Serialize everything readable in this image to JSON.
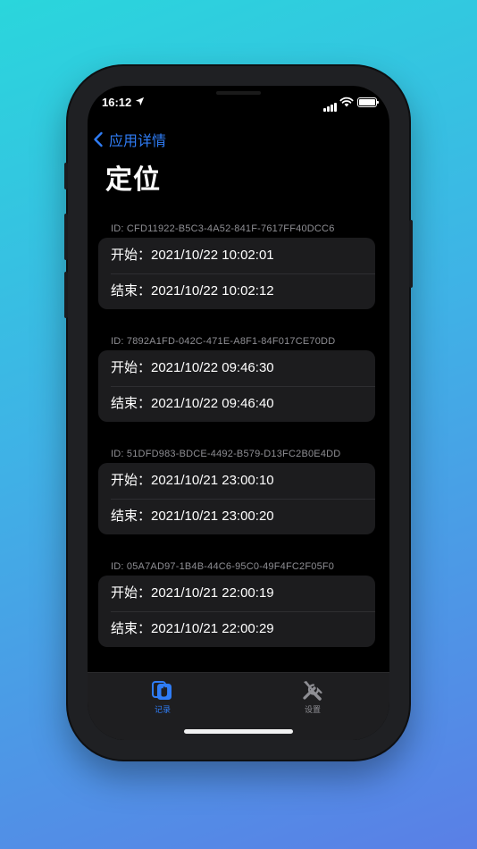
{
  "status_bar": {
    "time": "16:12"
  },
  "nav": {
    "back_label": "应用详情"
  },
  "page": {
    "title": "定位"
  },
  "records": [
    {
      "id": "ID: CFD11922-B5C3-4A52-841F-7617FF40DCC6",
      "start": "开始：2021/10/22 10:02:01",
      "end": "结束：2021/10/22 10:02:12"
    },
    {
      "id": "ID: 7892A1FD-042C-471E-A8F1-84F017CE70DD",
      "start": "开始：2021/10/22 09:46:30",
      "end": "结束：2021/10/22 09:46:40"
    },
    {
      "id": "ID: 51DFD983-BDCE-4492-B579-D13FC2B0E4DD",
      "start": "开始：2021/10/21 23:00:10",
      "end": "结束：2021/10/21 23:00:20"
    },
    {
      "id": "ID: 05A7AD97-1B4B-44C6-95C0-49F4FC2F05F0",
      "start": "开始：2021/10/21 22:00:19",
      "end": "结束：2021/10/21 22:00:29"
    }
  ],
  "tabbar": {
    "tabs": [
      {
        "label": "记录",
        "icon": "records-icon",
        "active": true
      },
      {
        "label": "设置",
        "icon": "settings-tools-icon",
        "active": false
      }
    ]
  },
  "colors": {
    "accent": "#2f7df6",
    "background": "#000000",
    "card": "#1c1c1e",
    "secondary_text": "#8e8e93"
  }
}
